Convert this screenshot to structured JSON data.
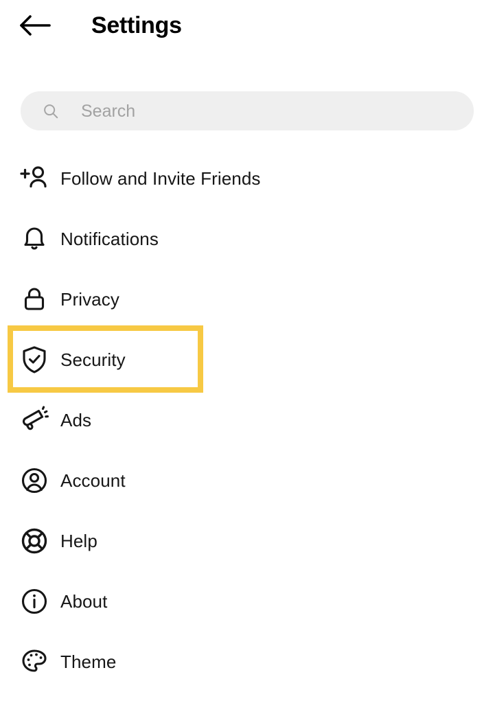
{
  "header": {
    "back_icon": "back-arrow-icon",
    "title": "Settings"
  },
  "search": {
    "icon": "search-icon",
    "placeholder": "Search",
    "value": ""
  },
  "settings_list": {
    "items": [
      {
        "label": "Follow and Invite Friends",
        "icon": "add-person-icon",
        "highlighted": false
      },
      {
        "label": "Notifications",
        "icon": "bell-icon",
        "highlighted": false
      },
      {
        "label": "Privacy",
        "icon": "lock-icon",
        "highlighted": false
      },
      {
        "label": "Security",
        "icon": "shield-check-icon",
        "highlighted": true
      },
      {
        "label": "Ads",
        "icon": "megaphone-icon",
        "highlighted": false
      },
      {
        "label": "Account",
        "icon": "person-circle-icon",
        "highlighted": false
      },
      {
        "label": "Help",
        "icon": "lifebuoy-icon",
        "highlighted": false
      },
      {
        "label": "About",
        "icon": "info-circle-icon",
        "highlighted": false
      },
      {
        "label": "Theme",
        "icon": "palette-icon",
        "highlighted": false
      }
    ]
  },
  "highlight": {
    "target_label": "Security",
    "color": "#f7c944"
  },
  "colors": {
    "background": "#ffffff",
    "text": "#161616",
    "search_field": "#efefef",
    "placeholder": "#a2a2a2",
    "highlight": "#f7c944"
  }
}
